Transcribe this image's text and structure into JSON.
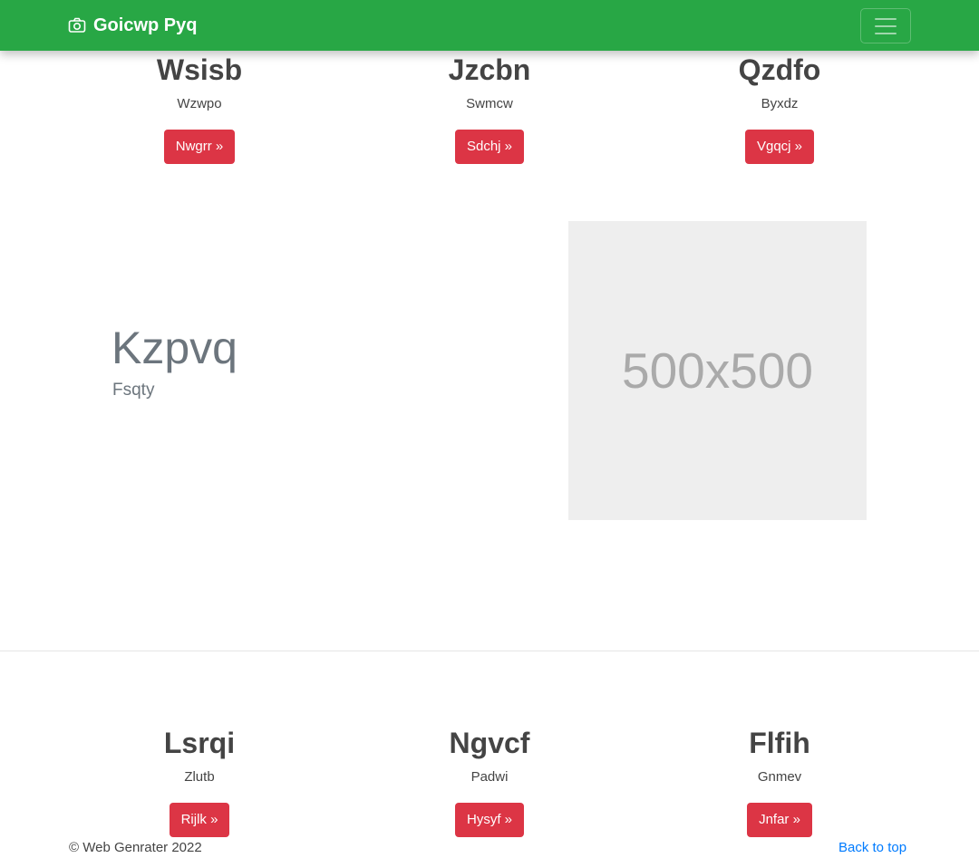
{
  "navbar": {
    "brand": "Goicwp Pyq",
    "brand_icon": "camera-icon",
    "toggler_icon": "hamburger-menu-icon",
    "background": "#28a745"
  },
  "top_features": [
    {
      "title": "Wsisb",
      "text": "Wzwpo",
      "button": "Nwgrr »"
    },
    {
      "title": "Jzcbn",
      "text": "Swmcw",
      "button": "Sdchj »"
    },
    {
      "title": "Qzdfo",
      "text": "Byxdz",
      "button": "Vgqcj »"
    }
  ],
  "hero": {
    "title": "Kzpvq",
    "subtitle": "Fsqty",
    "image_label": "500x500"
  },
  "bottom_features": [
    {
      "title": "Lsrqi",
      "text": "Zlutb",
      "button": "Rijlk »"
    },
    {
      "title": "Ngvcf",
      "text": "Padwi",
      "button": "Hysyf »"
    },
    {
      "title": "Flfih",
      "text": "Gnmev",
      "button": "Jnfar »"
    }
  ],
  "footer": {
    "copyright": "© Web Genrater 2022",
    "back_to_top": "Back to top"
  },
  "colors": {
    "accent": "#28a745",
    "button": "#dc3545",
    "link": "#007bff"
  }
}
